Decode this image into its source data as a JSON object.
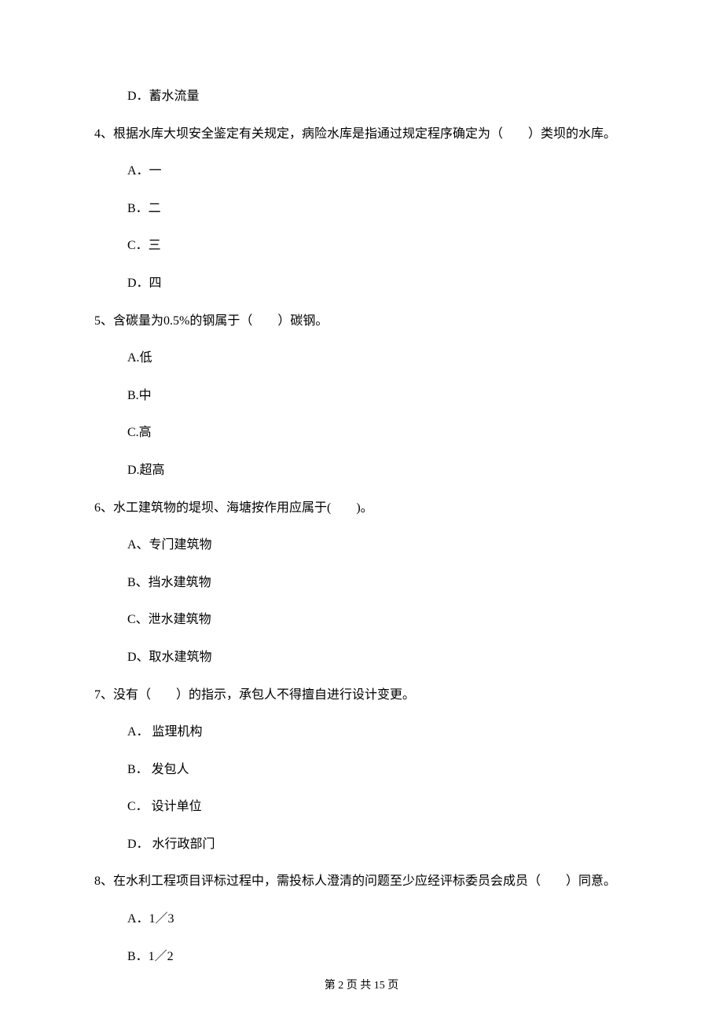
{
  "options_prefix_d_q3": "D．蓄水流量",
  "q4": {
    "text": "4、根据水库大坝安全鉴定有关规定，病险水库是指通过规定程序确定为（　　）类坝的水库。",
    "a": "A．一",
    "b": "B．二",
    "c": "C．三",
    "d": "D．四"
  },
  "q5": {
    "text": "5、含碳量为0.5%的钢属于（　　）碳钢。",
    "a": "A.低",
    "b": "B.中",
    "c": "C.高",
    "d": "D.超高"
  },
  "q6": {
    "text": "6、水工建筑物的堤坝、海塘按作用应属于(　　)。",
    "a": "A、专门建筑物",
    "b": "B、挡水建筑物",
    "c": "C、泄水建筑物",
    "d": "D、取水建筑物"
  },
  "q7": {
    "text": "7、没有（　　）的指示，承包人不得擅自进行设计变更。",
    "a": "A． 监理机构",
    "b": "B． 发包人",
    "c": "C． 设计单位",
    "d": "D． 水行政部门"
  },
  "q8": {
    "text": "8、在水利工程项目评标过程中，需投标人澄清的问题至少应经评标委员会成员（　　）同意。",
    "a": "A．1／3",
    "b": "B．1／2"
  },
  "footer": "第 2 页 共 15 页"
}
